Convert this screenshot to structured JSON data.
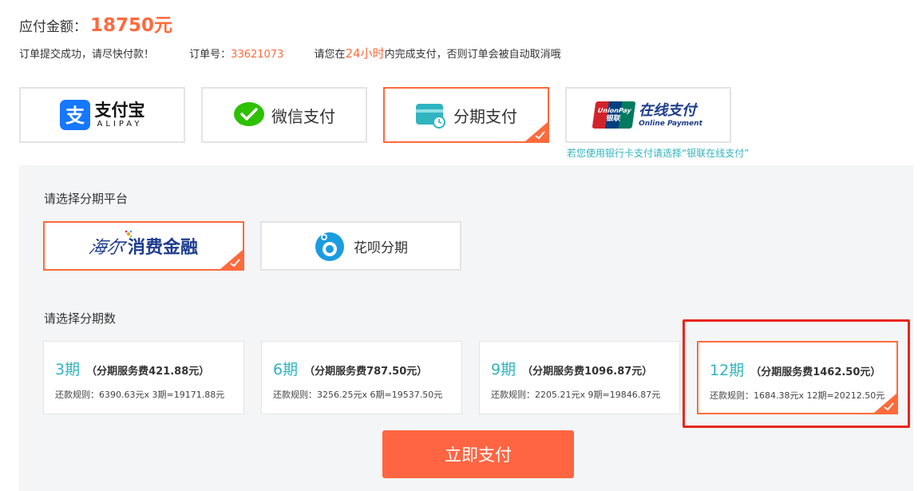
{
  "header": {
    "amount_label": "应付金额：",
    "amount_value": "18750元",
    "success_msg": "订单提交成功，请尽快付款！",
    "order_label": "订单号：",
    "order_no": "33621073",
    "deadline_pre": "请您在",
    "deadline_hours": "24小时",
    "deadline_post": "内完成支付，否则订单会被自动取消哦"
  },
  "payment_methods": [
    {
      "name": "支付宝",
      "sub": "ALIPAY",
      "icon": "alipay-icon",
      "selected": false
    },
    {
      "name": "微信支付",
      "icon": "wechat-icon",
      "selected": false
    },
    {
      "name": "分期支付",
      "icon": "installment-card-icon",
      "selected": true
    },
    {
      "name": "在线支付",
      "logo_text": "UnionPay",
      "logo_sub": "银联",
      "sub": "Online Payment",
      "icon": "unionpay-icon",
      "selected": false
    }
  ],
  "unionpay_note": "若您使用银行卡支付请选择“银联在线支付”",
  "platform_section": {
    "title": "请选择分期平台",
    "platforms": [
      {
        "name": "海尔消费金融",
        "brand_script": "海尔",
        "brand_text": "消费金融",
        "icon": "haier-finance-logo",
        "selected": true
      },
      {
        "name": "花呗分期",
        "icon": "huabei-icon",
        "selected": false
      }
    ]
  },
  "term_section": {
    "title": "请选择分期数",
    "terms": [
      {
        "count": "3期",
        "fee": "（分期服务费421.88元）",
        "rule": "还款规则：6390.63元x 3期=19171.88元",
        "selected": false
      },
      {
        "count": "6期",
        "fee": "（分期服务费787.50元）",
        "rule": "还款规则：3256.25元x 6期=19537.50元",
        "selected": false
      },
      {
        "count": "9期",
        "fee": "（分期服务费1096.87元）",
        "rule": "还款规则：2205.21元x 9期=19846.87元",
        "selected": false
      },
      {
        "count": "12期",
        "fee": "（分期服务费1462.50元）",
        "rule": "还款规则：1684.38元x 12期=20212.50元",
        "selected": true
      }
    ]
  },
  "pay_button_label": "立即支付",
  "colors": {
    "accent": "#ff6a3c",
    "teal": "#2fb4c0",
    "highlight_red": "#e8261c",
    "panel_bg": "#f4f5f7",
    "alipay_blue": "#1677ff",
    "wechat_green": "#2dc100"
  }
}
